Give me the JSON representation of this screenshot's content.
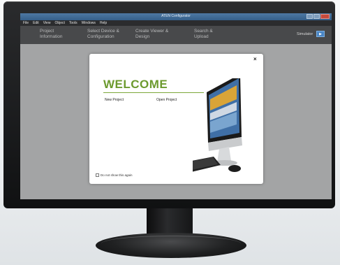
{
  "window": {
    "title": "ATEN Configurator"
  },
  "menu": [
    "File",
    "Edit",
    "View",
    "Object",
    "Tools",
    "Windows",
    "Help"
  ],
  "steps": [
    {
      "line1": "Project",
      "line2": "Information"
    },
    {
      "line1": "Select Device &",
      "line2": "Configuration"
    },
    {
      "line1": "Create Viewer &",
      "line2": "Design"
    },
    {
      "line1": "Search &",
      "line2": "Upload"
    }
  ],
  "simulator": {
    "label": "Simulator",
    "button": "▶"
  },
  "dialog": {
    "close": "×",
    "heading": "WELCOME",
    "new_project": "New Project",
    "open_project": "Open Project",
    "dont_show": "Do not show this again"
  },
  "colors": {
    "welcome_green": "#6c9a2e",
    "titlebar_blue": "#4d78a3",
    "simulator_blue": "#4a86c5"
  }
}
